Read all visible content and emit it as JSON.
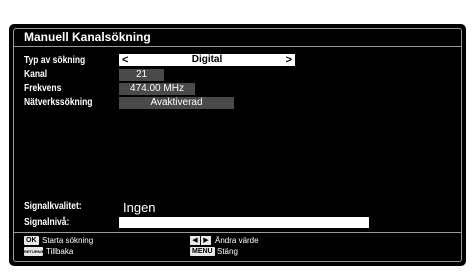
{
  "window": {
    "title": "Manuell Kanalsökning"
  },
  "settings": [
    {
      "label": "Typ av sökning",
      "value": "Digital"
    },
    {
      "label": "Kanal",
      "value": "21"
    },
    {
      "label": "Frekvens",
      "value": "474.00 MHz"
    },
    {
      "label": "Nätverkssökning",
      "value": "Avaktiverad"
    }
  ],
  "signal": {
    "quality_label": "Signalkvalitet:",
    "quality_value": "Ingen",
    "level_label": "Signalnivå:",
    "level_fraction": 1.0
  },
  "footer": {
    "ok_key": "OK",
    "ok_label": "Starta sökning",
    "back_key": "RETURN/BACK",
    "back_label": "Tillbaka",
    "change_label": "Ändra värde",
    "menu_key": "MENU",
    "menu_label": "Stäng"
  }
}
